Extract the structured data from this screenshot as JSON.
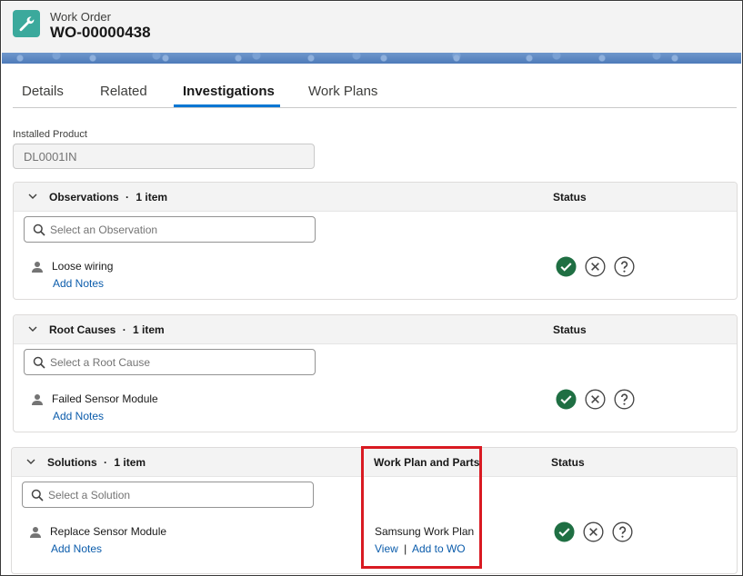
{
  "header": {
    "object_type": "Work Order",
    "record_name": "WO-00000438",
    "icon": "wrench-icon"
  },
  "tabs": [
    {
      "label": "Details",
      "active": false
    },
    {
      "label": "Related",
      "active": false
    },
    {
      "label": "Investigations",
      "active": true
    },
    {
      "label": "Work Plans",
      "active": false
    }
  ],
  "installed_product": {
    "label": "Installed Product",
    "value": "DL0001IN"
  },
  "observations": {
    "title": "Observations",
    "count": "1 item",
    "status_header": "Status",
    "search_placeholder": "Select an Observation",
    "items": [
      {
        "name": "Loose wiring",
        "action": "Add Notes"
      }
    ]
  },
  "root_causes": {
    "title": "Root Causes",
    "count": "1 item",
    "status_header": "Status",
    "search_placeholder": "Select a Root Cause",
    "items": [
      {
        "name": "Failed Sensor Module",
        "action": "Add Notes"
      }
    ]
  },
  "solutions": {
    "title": "Solutions",
    "count": "1 item",
    "work_plan_header": "Work Plan and Parts",
    "status_header": "Status",
    "search_placeholder": "Select a Solution",
    "items": [
      {
        "name": "Replace Sensor Module",
        "action": "Add Notes",
        "work_plan": "Samsung Work Plan",
        "view_label": "View",
        "separator": "|",
        "add_label": "Add to WO"
      }
    ]
  },
  "separator_dot": "·",
  "colors": {
    "accent": "#0176d3",
    "link": "#0b5cab",
    "confirm": "#2e844a",
    "icon_teal": "#3ba99c",
    "highlight": "#d91a22"
  }
}
